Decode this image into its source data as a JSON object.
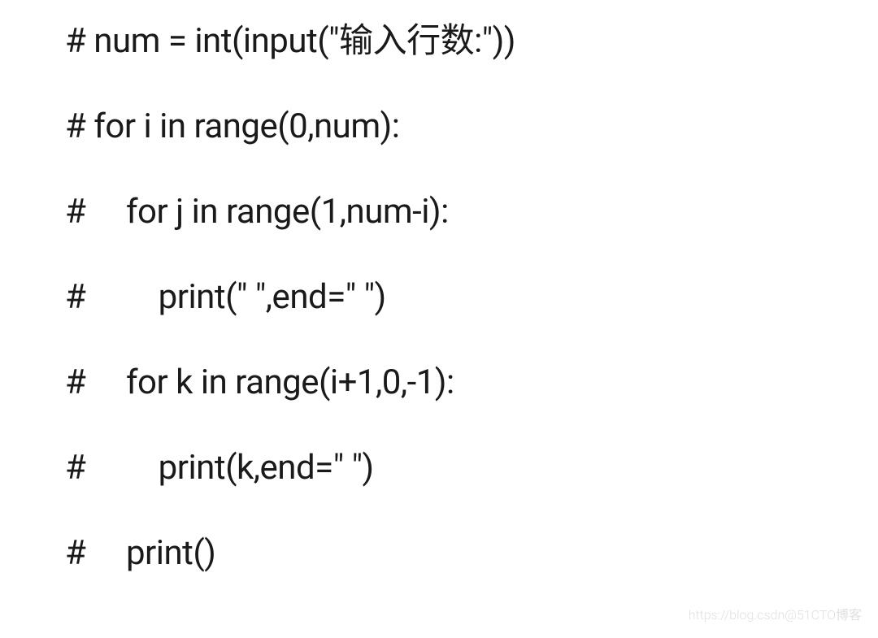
{
  "code": {
    "lines": [
      "# num = int(input(\"输入行数:\"))",
      "# for i in range(0,num):",
      "#     for j in range(1,num-i):",
      "#         print(\" \",end=\" \")",
      "#     for k in range(i+1,0,-1):",
      "#         print(k,end=\" \")",
      "#     print()"
    ]
  },
  "watermark": "https://blog.csdn@51CTO博客"
}
